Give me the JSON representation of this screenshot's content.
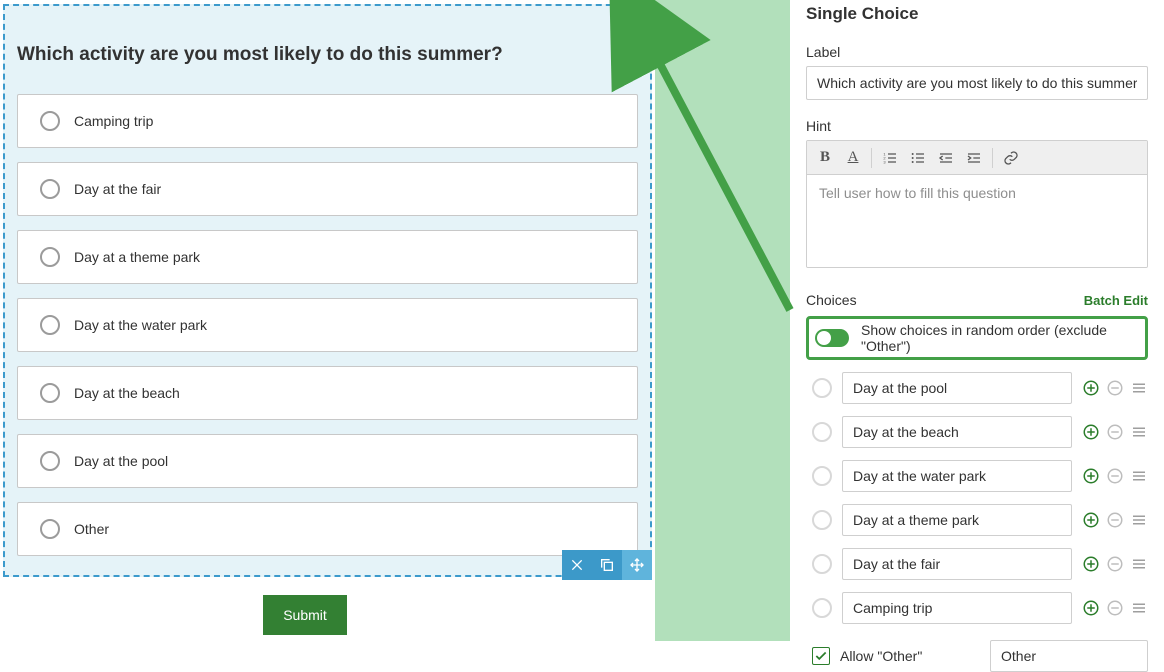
{
  "preview": {
    "question_title": "Which activity are you most likely to do this summer?",
    "choices": [
      "Camping trip",
      "Day at the fair",
      "Day at a theme park",
      "Day at the water park",
      "Day at the beach",
      "Day at the pool",
      "Other"
    ],
    "submit_label": "Submit"
  },
  "panel": {
    "title": "Single Choice",
    "label_field": {
      "label": "Label",
      "value": "Which activity are you most likely to do this summer?"
    },
    "hint_field": {
      "label": "Hint",
      "placeholder": "Tell user how to fill this question"
    },
    "choices_header": "Choices",
    "batch_edit_label": "Batch Edit",
    "random_toggle_label": "Show choices in random order (exclude \"Other\")",
    "choice_items": [
      "Day at the pool",
      "Day at the beach",
      "Day at the water park",
      "Day at a theme park",
      "Day at the fair",
      "Camping trip"
    ],
    "allow_other_label": "Allow \"Other\"",
    "other_value": "Other"
  },
  "colors": {
    "accent_green": "#43a047",
    "accent_blue": "#3c99c9",
    "preview_bg": "#e5f3f8",
    "separator_bg": "#b2e0bb"
  }
}
